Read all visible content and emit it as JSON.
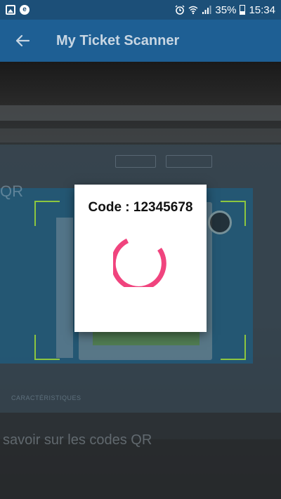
{
  "status_bar": {
    "battery": "35%",
    "time": "15:34",
    "left_icons": [
      "image-icon",
      "e-notification-icon"
    ],
    "right_icons": [
      "alarm-icon",
      "wifi-icon",
      "signal-icon",
      "battery-icon"
    ]
  },
  "app_bar": {
    "title": "My Ticket Scanner",
    "back_icon": "arrow-left-icon",
    "color": "#1e5f94"
  },
  "camera_preview": {
    "heading": "savoir sur les codes QR",
    "section_label": "CARACTÉRISTIQUES",
    "qr_label": "QR"
  },
  "scan_frame": {
    "color": "#8dc63f"
  },
  "dialog": {
    "code_text": "Code : 12345678",
    "spinner_color": "#f0447e"
  }
}
